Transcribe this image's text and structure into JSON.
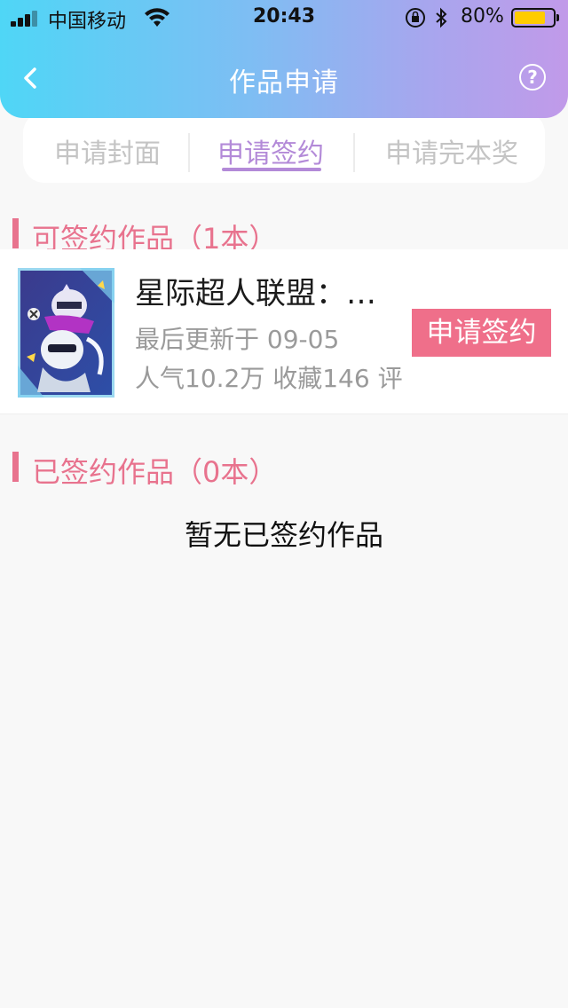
{
  "status_bar": {
    "carrier": "中国移动",
    "time": "20:43",
    "battery_percent_text": "80%",
    "battery_level": 0.8
  },
  "nav": {
    "title": "作品申请"
  },
  "tabs": [
    {
      "label": "申请封面",
      "active": false
    },
    {
      "label": "申请签约",
      "active": true
    },
    {
      "label": "申请完本奖",
      "active": false
    }
  ],
  "signable_section": {
    "title": "可签约作品（1本）",
    "works": [
      {
        "title": "星际超人联盟：…",
        "updated": "最后更新于 09-05",
        "stats": "人气10.2万 收藏146 评",
        "apply_label": "申请签约"
      }
    ]
  },
  "signed_section": {
    "title": "已签约作品（0本）",
    "empty_text": "暂无已签约作品"
  },
  "colors": {
    "accent_pink": "#e8738e",
    "button_pink": "#ef6f8a",
    "tab_active": "#b38ad8",
    "header_gradient_start": "#4fd6f6",
    "header_gradient_end": "#c19ae9"
  }
}
